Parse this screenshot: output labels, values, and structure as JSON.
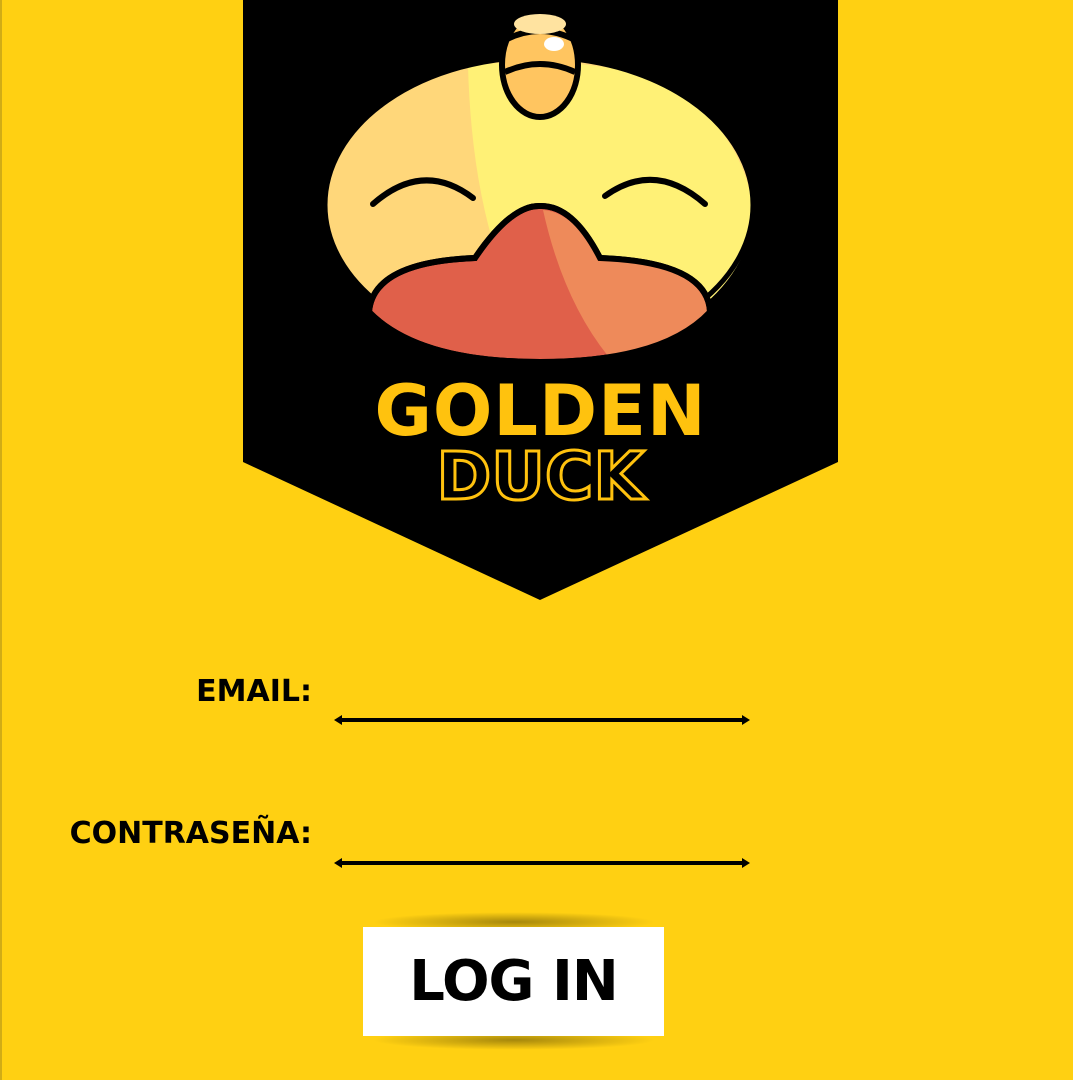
{
  "brand": {
    "line1": "GOLDEN",
    "line2": "DUCK",
    "logo_icon": "duck-face-icon"
  },
  "form": {
    "email_label": "EMAIL:",
    "email_value": "",
    "password_label": "CONTRASEÑA:",
    "password_value": "",
    "login_label": "LOG IN"
  },
  "colors": {
    "background": "#FFD012",
    "banner": "#000000",
    "brand_gold": "#FFC20E",
    "button": "#FFFFFF"
  }
}
